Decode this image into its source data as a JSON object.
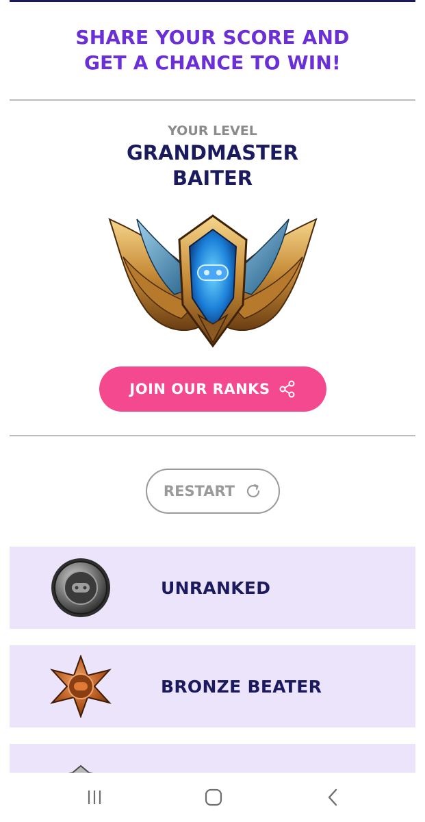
{
  "header": {
    "headline_line1": "SHARE YOUR SCORE AND",
    "headline_line2": "GET A CHANCE TO WIN!"
  },
  "result": {
    "level_label": "YOUR LEVEL",
    "level_name_line1": "GRANDMASTER",
    "level_name_line2": "BAITER",
    "emblem_icon": "grandmaster-winged-emblem-icon"
  },
  "actions": {
    "join_label": "JOIN OUR RANKS",
    "join_icon": "share-icon",
    "restart_label": "RESTART",
    "restart_icon": "refresh-icon"
  },
  "ranks": [
    {
      "label": "UNRANKED",
      "icon": "unranked-badge-icon"
    },
    {
      "label": "BRONZE BEATER",
      "icon": "bronze-badge-icon"
    },
    {
      "label": "",
      "icon": "silver-badge-icon"
    }
  ],
  "nav": {
    "recents_icon": "recents-icon",
    "home_icon": "home-icon",
    "back_icon": "back-icon"
  },
  "colors": {
    "headline": "#6a2fd6",
    "title": "#1c1a5e",
    "join_button": "#f4498f",
    "rank_row_bg": "#ebe4fb",
    "muted": "#8b8b8b"
  }
}
